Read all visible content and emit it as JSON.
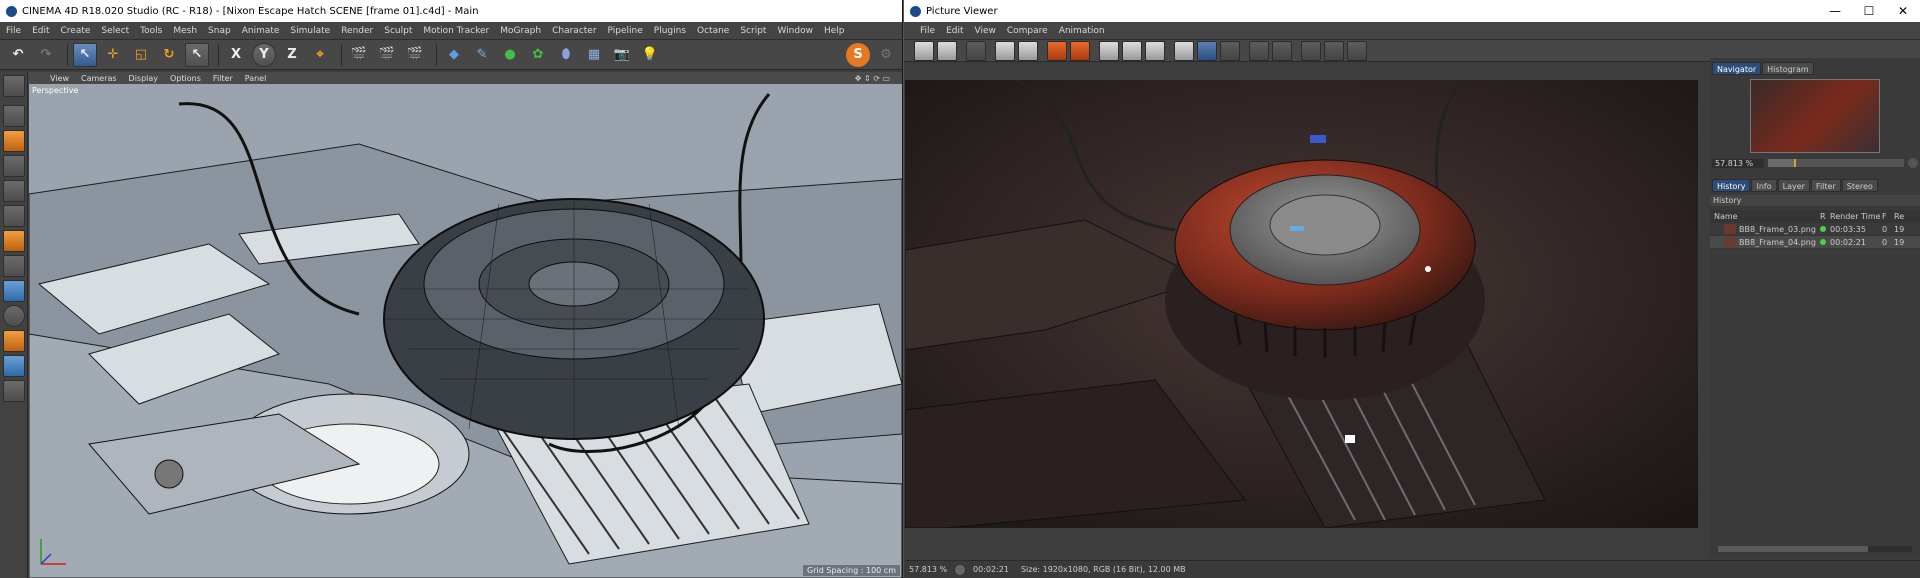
{
  "c4d": {
    "title": "CINEMA 4D R18.020 Studio (RC - R18) - [Nixon Escape Hatch SCENE [frame 01].c4d] - Main",
    "menu": [
      "File",
      "Edit",
      "Create",
      "Select",
      "Tools",
      "Mesh",
      "Snap",
      "Animate",
      "Simulate",
      "Render",
      "Sculpt",
      "Motion Tracker",
      "MoGraph",
      "Character",
      "Pipeline",
      "Plugins",
      "Octane",
      "Script",
      "Window",
      "Help"
    ],
    "axis_x": "X",
    "axis_y": "Y",
    "axis_z": "Z",
    "viewport_menu": [
      "View",
      "Cameras",
      "Display",
      "Options",
      "Filter",
      "Panel"
    ],
    "viewport_label": "Perspective",
    "grid_spacing": "Grid Spacing : 100 cm"
  },
  "pv": {
    "title": "Picture Viewer",
    "menu": [
      "File",
      "Edit",
      "View",
      "Compare",
      "Animation"
    ],
    "nav_tabs": [
      "Navigator",
      "Histogram"
    ],
    "zoom": "57.813 %",
    "panel_tabs": [
      "History",
      "Info",
      "Layer",
      "Filter",
      "Stereo"
    ],
    "history_title": "History",
    "columns": [
      "Name",
      "R",
      "Render Time",
      "F",
      "Re"
    ],
    "rows": [
      {
        "name": "BB8_Frame_03.png",
        "time": "00:03:35",
        "f": "0",
        "re": "19"
      },
      {
        "name": "BB8_Frame_04.png",
        "time": "00:02:21",
        "f": "0",
        "re": "19"
      }
    ],
    "status_zoom": "57.813 %",
    "status_time": "00:02:21",
    "status_size": "Size: 1920x1080, RGB (16 Bit), 12.00 MB"
  },
  "colors": {
    "accent": "#2c4d7a",
    "render_red": "#b8402a",
    "status_green": "#4cd04c"
  }
}
